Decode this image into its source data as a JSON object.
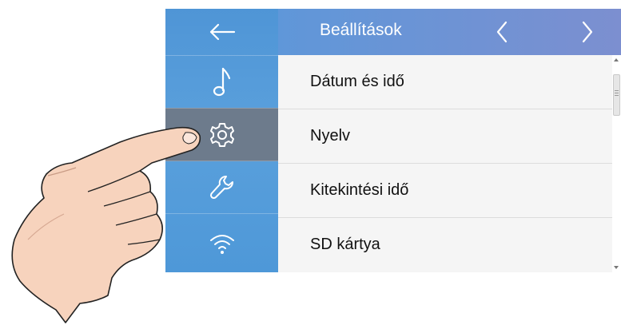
{
  "header": {
    "title": "Beállítások",
    "back_icon": "arrow-left-icon",
    "prev_icon": "chevron-left-icon",
    "next_icon": "chevron-right-icon"
  },
  "sidebar": {
    "items": [
      {
        "icon": "music-note-icon",
        "active": false
      },
      {
        "icon": "gear-icon",
        "active": true
      },
      {
        "icon": "wrench-icon",
        "active": false
      },
      {
        "icon": "wifi-icon",
        "active": false
      }
    ]
  },
  "menu": {
    "items": [
      {
        "label": "Dátum és idő"
      },
      {
        "label": "Nyelv"
      },
      {
        "label": "Kitekintési idő"
      },
      {
        "label": "SD kártya"
      }
    ]
  },
  "colors": {
    "sidebar": "#4f95d6",
    "header_start": "#5f97d9",
    "header_end": "#7c8fd0",
    "active_item": "#6d7b8c",
    "list_bg": "#f5f5f5"
  },
  "illustration": "pointing-hand-icon"
}
